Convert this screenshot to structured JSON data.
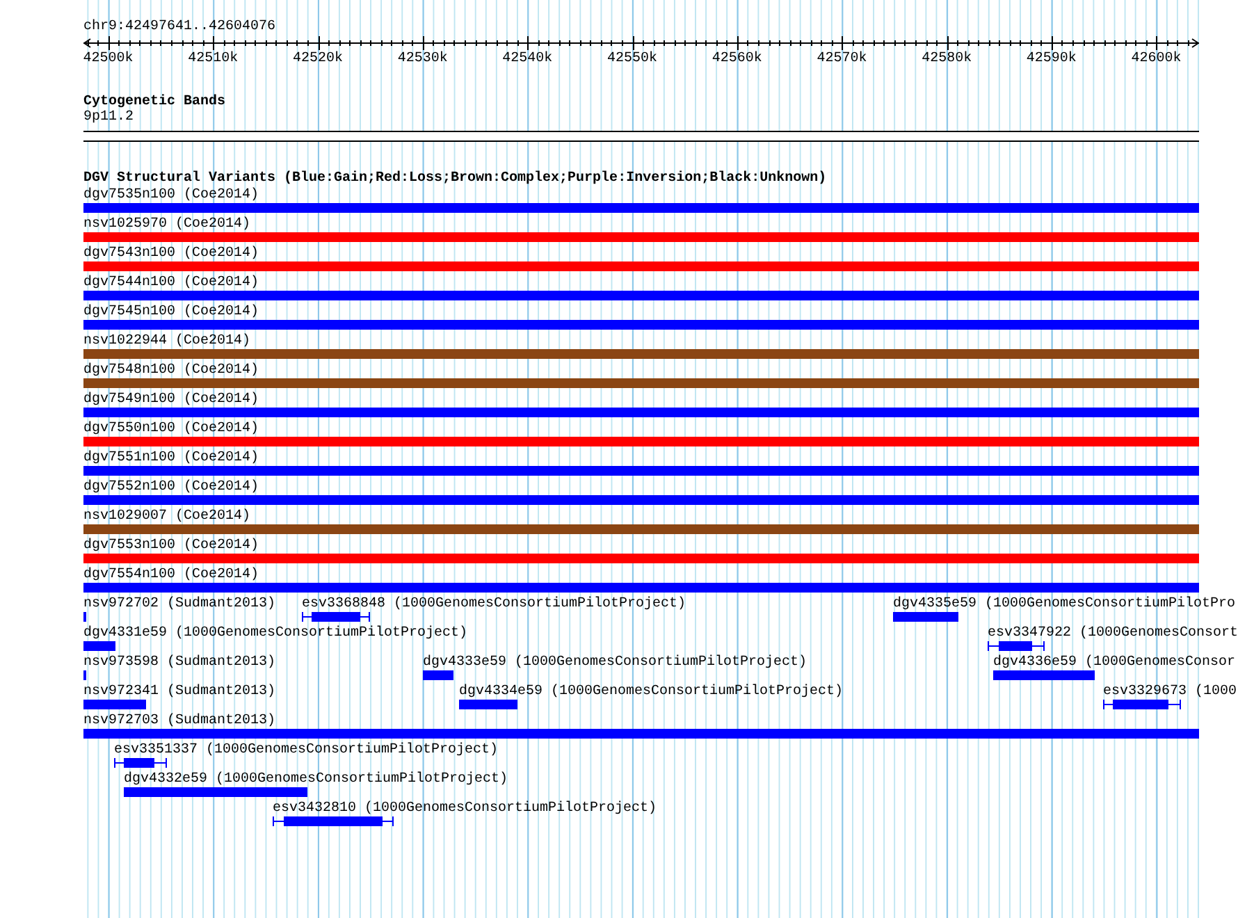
{
  "location": "chr9:42497641..42604076",
  "ruler": {
    "ticks": [
      {
        "label": "42500k"
      },
      {
        "label": "42510k"
      },
      {
        "label": "42520k"
      },
      {
        "label": "42530k"
      },
      {
        "label": "42540k"
      },
      {
        "label": "42550k"
      },
      {
        "label": "42560k"
      },
      {
        "label": "42570k"
      },
      {
        "label": "42580k"
      },
      {
        "label": "42590k"
      },
      {
        "label": "42600k"
      }
    ]
  },
  "tracks": [
    {
      "kind": "bands",
      "title": "Cytogenetic Bands",
      "features": [
        {
          "label": "9p11.2"
        }
      ]
    },
    {
      "kind": "variants",
      "title": "DGV Structural Variants (Blue:Gain;Red:Loss;Brown:Complex;Purple:Inversion;Black:Unknown)",
      "rows": [
        {
          "features": [
            {
              "kind": "plain",
              "label": "dgv7535n100 (Coe2014)",
              "color": "#0000ff"
            }
          ]
        },
        {
          "features": [
            {
              "kind": "plain",
              "label": "nsv1025970 (Coe2014)",
              "color": "#ff0000"
            }
          ]
        },
        {
          "features": [
            {
              "kind": "plain",
              "label": "dgv7543n100 (Coe2014)",
              "color": "#ff0000"
            }
          ]
        },
        {
          "features": [
            {
              "kind": "plain",
              "label": "dgv7544n100 (Coe2014)",
              "color": "#0000ff"
            }
          ]
        },
        {
          "features": [
            {
              "kind": "plain",
              "label": "dgv7545n100 (Coe2014)",
              "color": "#0000ff"
            }
          ]
        },
        {
          "features": [
            {
              "kind": "plain",
              "label": "nsv1022944 (Coe2014)",
              "color": "#8b4513"
            }
          ]
        },
        {
          "features": [
            {
              "kind": "plain",
              "label": "dgv7548n100 (Coe2014)",
              "color": "#8b4513"
            }
          ]
        },
        {
          "features": [
            {
              "kind": "plain",
              "label": "dgv7549n100 (Coe2014)",
              "color": "#0000ff"
            }
          ]
        },
        {
          "features": [
            {
              "kind": "plain",
              "label": "dgv7550n100 (Coe2014)",
              "color": "#ff0000"
            }
          ]
        },
        {
          "features": [
            {
              "kind": "plain",
              "label": "dgv7551n100 (Coe2014)",
              "color": "#0000ff"
            }
          ]
        },
        {
          "features": [
            {
              "kind": "plain",
              "label": "dgv7552n100 (Coe2014)",
              "color": "#0000ff"
            }
          ]
        },
        {
          "features": [
            {
              "kind": "plain",
              "label": "nsv1029007 (Coe2014)",
              "color": "#8b4513"
            }
          ]
        },
        {
          "features": [
            {
              "kind": "plain",
              "label": "dgv7553n100 (Coe2014)",
              "color": "#ff0000"
            }
          ]
        },
        {
          "features": [
            {
              "kind": "plain",
              "label": "dgv7554n100 (Coe2014)",
              "color": "#0000ff"
            }
          ]
        },
        {
          "features": [
            {
              "kind": "plain",
              "label": "nsv972702 (Sudmant2013)",
              "color": "#0000ff"
            },
            {
              "kind": "whisker",
              "label": "esv3368848 (1000GenomesConsortiumPilotProject)",
              "color": "#0000ff"
            },
            {
              "kind": "plain",
              "label": "dgv4335e59 (1000GenomesConsortiumPilotPro",
              "color": "#0000ff"
            }
          ]
        },
        {
          "features": [
            {
              "kind": "plain",
              "label": "dgv4331e59 (1000GenomesConsortiumPilotProject)",
              "color": "#0000ff"
            },
            {
              "kind": "whisker",
              "label": "esv3347922 (1000GenomesConsort",
              "color": "#0000ff"
            }
          ]
        },
        {
          "features": [
            {
              "kind": "plain",
              "label": "nsv973598 (Sudmant2013)",
              "color": "#0000ff"
            },
            {
              "kind": "plain",
              "label": "dgv4333e59 (1000GenomesConsortiumPilotProject)",
              "color": "#0000ff"
            },
            {
              "kind": "plain",
              "label": "dgv4336e59 (1000GenomesConsor",
              "color": "#0000ff"
            }
          ]
        },
        {
          "features": [
            {
              "kind": "plain",
              "label": "nsv972341 (Sudmant2013)",
              "color": "#0000ff"
            },
            {
              "kind": "plain",
              "label": "dgv4334e59 (1000GenomesConsortiumPilotProject)",
              "color": "#0000ff"
            },
            {
              "kind": "whisker",
              "label": "esv3329673 (1000",
              "color": "#0000ff"
            }
          ]
        },
        {
          "features": [
            {
              "kind": "plain",
              "label": "nsv972703 (Sudmant2013)",
              "color": "#0000ff"
            }
          ]
        },
        {
          "features": [
            {
              "kind": "whisker",
              "label": "esv3351337 (1000GenomesConsortiumPilotProject)",
              "color": "#0000ff"
            }
          ]
        },
        {
          "features": [
            {
              "kind": "plain",
              "label": "dgv4332e59 (1000GenomesConsortiumPilotProject)",
              "color": "#0000ff"
            }
          ]
        },
        {
          "features": [
            {
              "kind": "whisker",
              "label": "esv3432810 (1000GenomesConsortiumPilotProject)",
              "color": "#0000ff"
            }
          ]
        }
      ]
    }
  ]
}
